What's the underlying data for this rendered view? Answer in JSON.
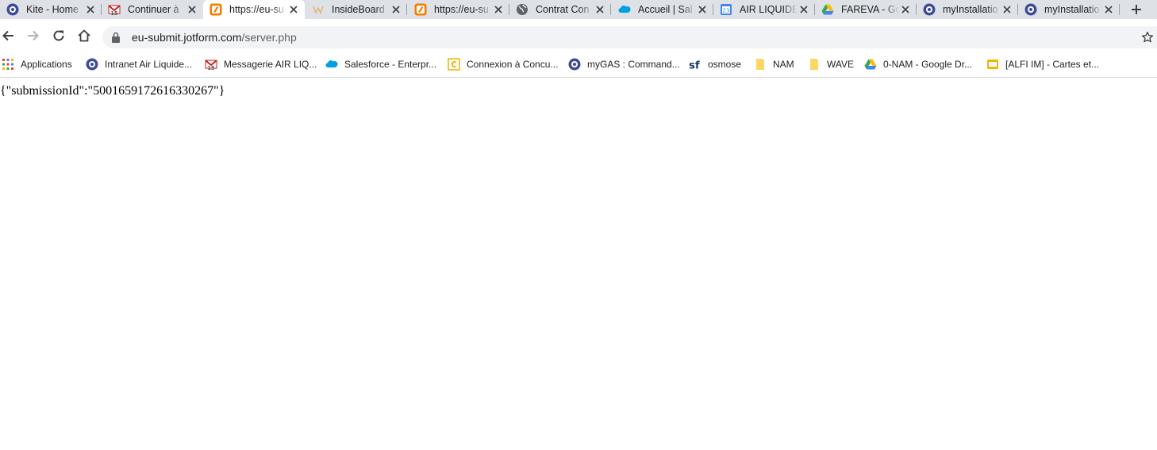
{
  "tabs": [
    {
      "title": "Kite - Home",
      "icon": "circle-q-icon"
    },
    {
      "title": "Continuer à",
      "icon": "gmail-icon"
    },
    {
      "title": "https://eu-su",
      "icon": "jotform-icon",
      "active": true
    },
    {
      "title": "InsideBoard",
      "icon": "insideboard-icon"
    },
    {
      "title": "https://eu-su",
      "icon": "jotform-icon"
    },
    {
      "title": "Contrat Con",
      "icon": "globe-icon"
    },
    {
      "title": "Accueil | Sal",
      "icon": "salesforce-icon"
    },
    {
      "title": "AIR LIQUIDE",
      "icon": "calendar-icon"
    },
    {
      "title": "FAREVA - Go",
      "icon": "drive-icon"
    },
    {
      "title": "myInstallatio",
      "icon": "circle-q-icon"
    },
    {
      "title": "myInstallatio",
      "icon": "circle-q-icon"
    }
  ],
  "address": {
    "host": "eu-submit.jotform.com",
    "path": "/server.php"
  },
  "bookmarks": [
    {
      "label": "Applications",
      "icon": "apps-grid-icon"
    },
    {
      "label": "Intranet Air Liquide...",
      "icon": "circle-q-icon"
    },
    {
      "label": "Messagerie AIR LIQ...",
      "icon": "gmail-icon"
    },
    {
      "label": "Salesforce - Enterpr...",
      "icon": "salesforce-icon"
    },
    {
      "label": "Connexion à Concu...",
      "icon": "concur-icon"
    },
    {
      "label": "myGAS : Command...",
      "icon": "circle-q-icon"
    },
    {
      "label": "osmose",
      "icon": "sf-icon"
    },
    {
      "label": "NAM",
      "icon": "note-icon"
    },
    {
      "label": "WAVE",
      "icon": "note-icon"
    },
    {
      "label": "0-NAM - Google Dr...",
      "icon": "drive-icon"
    },
    {
      "label": "[ALFI IM] - Cartes et...",
      "icon": "slides-icon"
    }
  ],
  "page": {
    "body_text": "{\"submissionId\":\"5001659172616330267\"}"
  },
  "colors": {
    "tabstrip": "#dee1e6",
    "omnibox": "#f1f3f4",
    "jotform_orange": "#f57c00",
    "salesforce_blue": "#00a1e0",
    "q_blue": "#3d4b9a"
  }
}
